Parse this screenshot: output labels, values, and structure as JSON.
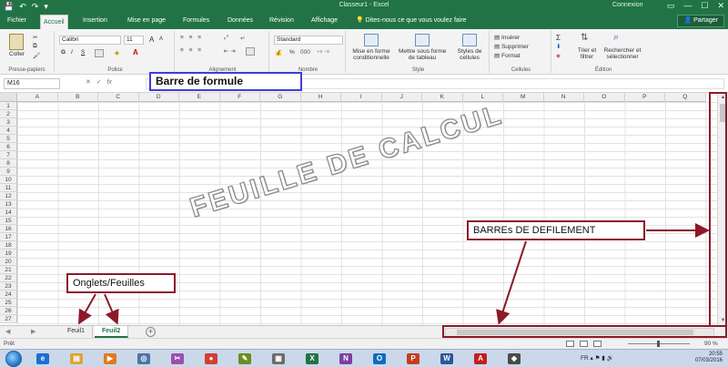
{
  "window": {
    "title": "Classeur1 - Excel",
    "account": "Connexion",
    "qat": [
      "💾",
      "↶",
      "↷",
      "▾"
    ],
    "controls": [
      "▭",
      "—",
      "☐",
      "✕"
    ]
  },
  "tabs": [
    {
      "label": "Fichier"
    },
    {
      "label": "Accueil",
      "active": true
    },
    {
      "label": "Insertion"
    },
    {
      "label": "Mise en page"
    },
    {
      "label": "Formules"
    },
    {
      "label": "Données"
    },
    {
      "label": "Révision"
    },
    {
      "label": "Affichage"
    }
  ],
  "tell_me": "Dites-nous ce que vous voulez faire",
  "share": "Partager",
  "ribbon": {
    "clipboard": {
      "paste": "Coller",
      "label": "Presse-papiers"
    },
    "font": {
      "name": "Calibri",
      "size": "11",
      "grow": "A",
      "shrink": "A",
      "bold": "G",
      "italic": "I",
      "underline": "S",
      "color": "A",
      "label": "Police"
    },
    "alignment": {
      "label": "Alignement"
    },
    "number": {
      "format": "Standard",
      "percent": "%",
      "label": "Nombre"
    },
    "style": {
      "conditional": [
        "Mise en forme",
        "conditionnelle"
      ],
      "table": [
        "Mettre sous forme",
        "de tableau"
      ],
      "cell_styles": [
        "Styles de",
        "cellules"
      ],
      "label": "Style"
    },
    "cells": {
      "insert": "Insérer",
      "delete": "Supprimer",
      "format": "Format",
      "label": "Cellules"
    },
    "editing": {
      "sort": [
        "Trier et",
        "filtrer"
      ],
      "find": [
        "Rechercher et",
        "sélectionner"
      ],
      "label": "Édition"
    }
  },
  "formula_bar": {
    "name_box": "M16",
    "fx": "fx",
    "value": ""
  },
  "columns": [
    "A",
    "B",
    "C",
    "D",
    "E",
    "F",
    "G",
    "H",
    "I",
    "J",
    "K",
    "L",
    "M",
    "N",
    "O",
    "P",
    "Q"
  ],
  "rows": [
    "1",
    "2",
    "3",
    "4",
    "5",
    "6",
    "7",
    "8",
    "9",
    "10",
    "11",
    "12",
    "13",
    "14",
    "15",
    "16",
    "17",
    "18",
    "19",
    "20",
    "21",
    "22",
    "23",
    "24",
    "25",
    "26",
    "27"
  ],
  "sheets": [
    {
      "label": "Feuil1"
    },
    {
      "label": "Feuil2",
      "active": true
    }
  ],
  "add_sheet": "+",
  "status": {
    "ready": "Prêt",
    "zoom": "90 %"
  },
  "taskbar": {
    "apps": [
      {
        "name": "ie",
        "glyph": "e",
        "color": "#1e6fd0"
      },
      {
        "name": "explorer",
        "glyph": "▤",
        "color": "#d9a53a"
      },
      {
        "name": "media",
        "glyph": "▶",
        "color": "#e07b1c"
      },
      {
        "name": "network",
        "glyph": "◎",
        "color": "#4a76a8"
      },
      {
        "name": "tool",
        "glyph": "✂",
        "color": "#9a4fb0"
      },
      {
        "name": "chrome",
        "glyph": "●",
        "color": "#d23f31"
      },
      {
        "name": "paint",
        "glyph": "✎",
        "color": "#6b8e23"
      },
      {
        "name": "calc",
        "glyph": "▦",
        "color": "#6b6b6b"
      },
      {
        "name": "excel",
        "glyph": "X",
        "color": "#217346"
      },
      {
        "name": "onenote",
        "glyph": "N",
        "color": "#7b3fa0"
      },
      {
        "name": "outlook",
        "glyph": "O",
        "color": "#0f6cbd"
      },
      {
        "name": "powerpoint",
        "glyph": "P",
        "color": "#c43e1c"
      },
      {
        "name": "word",
        "glyph": "W",
        "color": "#2b579a"
      },
      {
        "name": "pdf",
        "glyph": "A",
        "color": "#c41e1e"
      },
      {
        "name": "app",
        "glyph": "◆",
        "color": "#4a4a4a"
      }
    ],
    "tray_lang": "FR",
    "time": "20:55",
    "date": "07/03/2016"
  },
  "annotations": {
    "formula_bar": "Barre de formule",
    "sheet_tabs": "Onglets/Feuilles",
    "scrollbars": "BARREs DE DEFILEMENT",
    "watermark": "FEUILLE DE CALCUL"
  },
  "colors": {
    "excel_green": "#217346",
    "annotation_red": "#8b1a2a",
    "annotation_blue": "#3d3ddb"
  }
}
